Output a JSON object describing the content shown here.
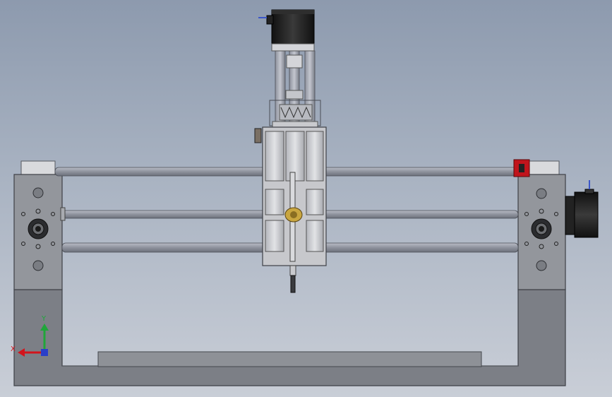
{
  "viewport": {
    "colors": {
      "background_top": "#8d9aae",
      "background_bottom": "#c9ced7",
      "frame": "#7c7f86",
      "plate": "#93969c",
      "rail": "#8e929d",
      "gantry": "#c7c8cc",
      "motor": "#1e1e1e",
      "limit_switch": "#c0141c",
      "brass": "#c9a640"
    }
  },
  "triad": {
    "x_label": "X",
    "y_label": "Y",
    "x_color": "#d2141c",
    "y_color": "#1fa63a",
    "z_color": "#2a3fc9"
  }
}
